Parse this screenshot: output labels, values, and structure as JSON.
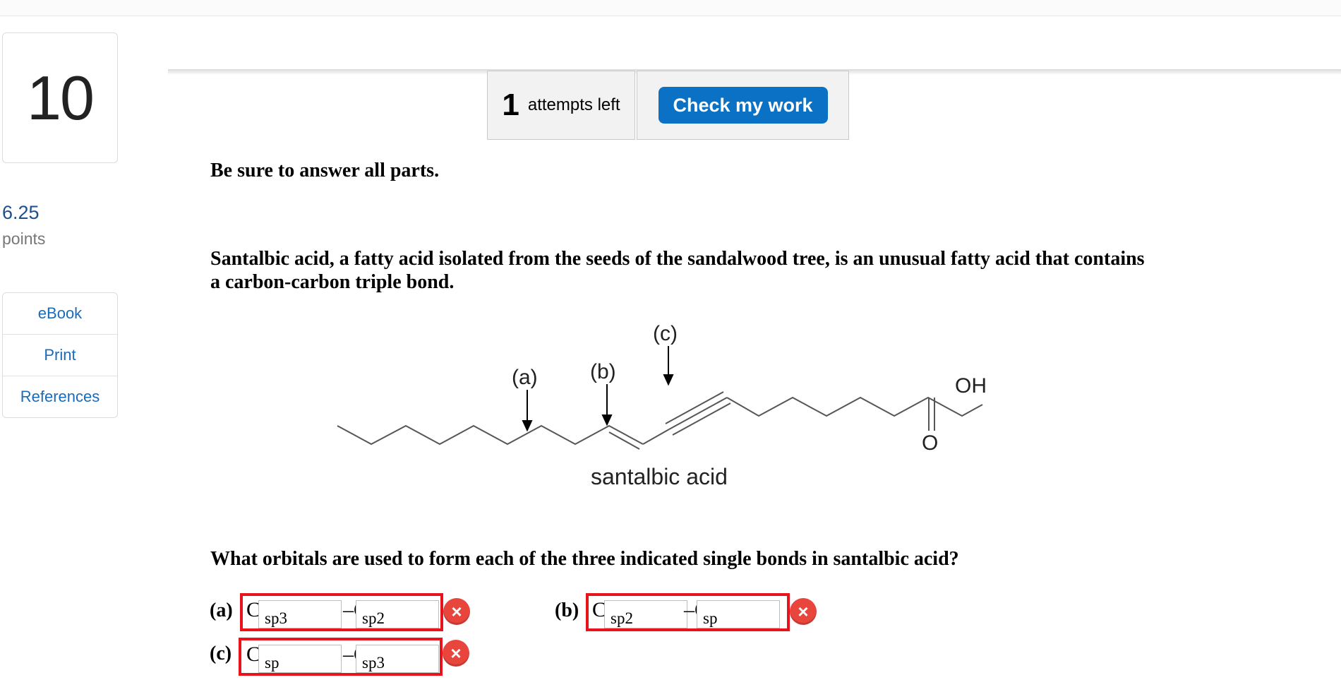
{
  "question": {
    "number": "10",
    "points_value": "6.25",
    "points_label": "points"
  },
  "sidebar": {
    "links": [
      "eBook",
      "Print",
      "References"
    ]
  },
  "header": {
    "attempts_count": "1",
    "attempts_label": "attempts left",
    "check_label": "Check my work"
  },
  "content": {
    "instruction": "Be sure to answer all parts.",
    "intro": "Santalbic acid, a fatty acid isolated from the seeds of the sandalwood tree, is an unusual fatty acid that contains a carbon-carbon triple bond.",
    "question": "What orbitals are used to form each of the three indicated single bonds in santalbic acid?"
  },
  "figure": {
    "labels": {
      "a": "(a)",
      "b": "(b)",
      "c": "(c)"
    },
    "oh": "OH",
    "o": "O",
    "caption": "santalbic acid"
  },
  "answers": {
    "a": {
      "label": "(a)",
      "prefix1": "C",
      "value1": "sp3",
      "prefix2": "–C",
      "value2": "sp2",
      "status": "incorrect"
    },
    "b": {
      "label": "(b)",
      "prefix1": "C",
      "value1": "sp2",
      "prefix2": "–C",
      "value2": "sp",
      "status": "incorrect"
    },
    "c": {
      "label": "(c)",
      "prefix1": "C",
      "value1": "sp",
      "prefix2": "–C",
      "value2": "sp3",
      "status": "incorrect"
    }
  },
  "icons": {
    "incorrect": "x-circle-icon",
    "incorrect_color": "#e8453d",
    "button_color": "#0b71c4"
  }
}
